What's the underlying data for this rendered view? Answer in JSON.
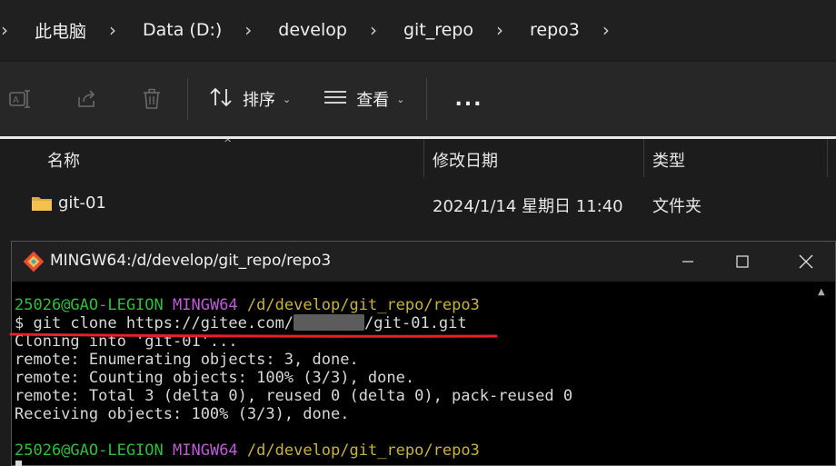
{
  "breadcrumb": {
    "items": [
      "此电脑",
      "Data (D:)",
      "develop",
      "git_repo",
      "repo3"
    ],
    "separator": ">"
  },
  "toolbar": {
    "sort_label": "排序",
    "view_label": "查看",
    "more_label": "..."
  },
  "file_list": {
    "columns": [
      "名称",
      "修改日期",
      "类型"
    ],
    "rows": [
      {
        "name": "git-01",
        "modified": "2024/1/14 星期日 11:40",
        "type": "文件夹"
      }
    ]
  },
  "terminal": {
    "title": "MINGW64:/d/develop/git_repo/repo3",
    "prompt_user": "25026@GAO-LEGION",
    "prompt_env": "MINGW64",
    "prompt_path": "/d/develop/git_repo/repo3",
    "command_prefix": "$ git clone https://gitee.com/",
    "command_suffix": "/git-01.git",
    "output": [
      "Cloning into 'git-01'...",
      "remote: Enumerating objects: 3, done.",
      "remote: Counting objects: 100% (3/3), done.",
      "remote: Total 3 (delta 0), reused 0 (delta 0), pack-reused 0",
      "Receiving objects: 100% (3/3), done."
    ],
    "empty_line": "",
    "prompt2_user": "25026@GAO-LEGION",
    "prompt2_env": "MINGW64",
    "prompt2_path": "/d/develop/git_repo/repo3"
  },
  "colors": {
    "prompt_user": "#2ebf3a",
    "prompt_env": "#c05bd6",
    "prompt_path": "#c9b33a",
    "annotation": "#e8202a",
    "folder": "#f2c14e"
  },
  "icons": [
    "rename-icon",
    "share-icon",
    "delete-icon",
    "sort-icon",
    "view-icon",
    "folder-icon",
    "git-icon",
    "minimize-icon",
    "maximize-icon",
    "close-icon"
  ]
}
